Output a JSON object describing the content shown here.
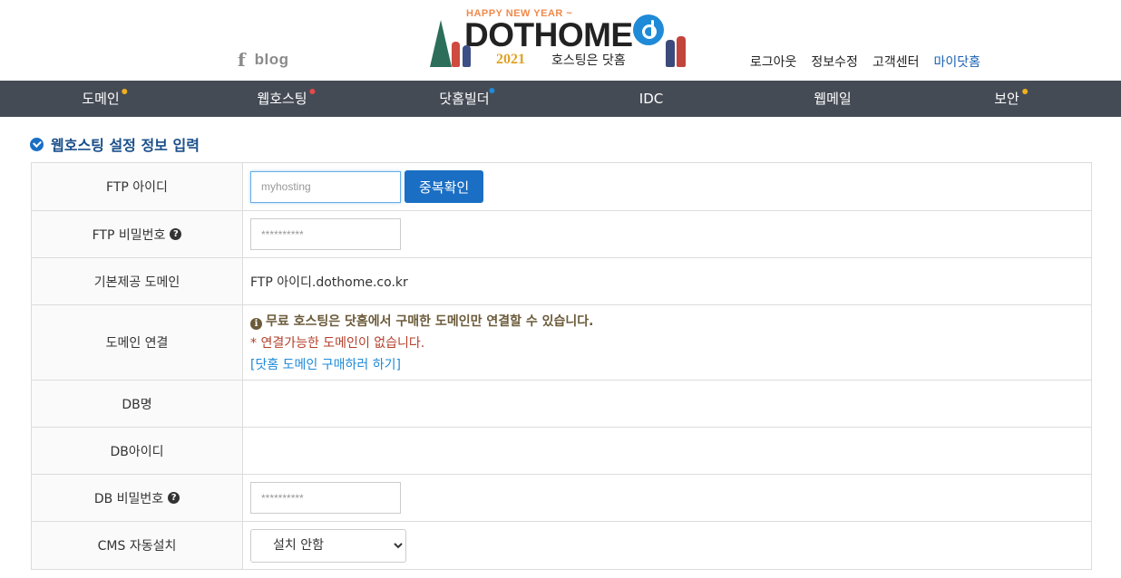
{
  "header": {
    "social": {
      "facebook_glyph": "f",
      "blog_label": "blog"
    },
    "logo": {
      "banner": "HAPPY NEW YEAR ~",
      "brand": "DOTHOME",
      "year": "2021",
      "tagline": "호스팅은 닷홈"
    },
    "links": [
      {
        "label": "로그아웃"
      },
      {
        "label": "정보수정"
      },
      {
        "label": "고객센터"
      },
      {
        "label": "마이닷홈"
      }
    ]
  },
  "nav": {
    "items": [
      {
        "label": "도메인",
        "dot_color": "#f2b01e"
      },
      {
        "label": "웹호스팅",
        "dot_color": "#e84a4a"
      },
      {
        "label": "닷홈빌더",
        "dot_color": "#1f8ad8"
      },
      {
        "label": "IDC",
        "dot_color": ""
      },
      {
        "label": "웹메일",
        "dot_color": ""
      },
      {
        "label": "보안",
        "dot_color": "#f2b01e"
      }
    ]
  },
  "section": {
    "title": "웹호스팅 설정 정보 입력"
  },
  "form": {
    "ftp_id": {
      "label": "FTP 아이디",
      "placeholder": "myhosting",
      "check_button": "중복확인"
    },
    "ftp_password": {
      "label": "FTP 비밀번호",
      "value": "**********"
    },
    "default_domain": {
      "label": "기본제공 도메인",
      "value": "FTP 아이디.dothome.co.kr"
    },
    "domain_connect": {
      "label": "도메인 연결",
      "notice": "무료 호스팅은 닷홈에서 구매한 도메인만 연결할 수 있습니다.",
      "warning": "* 연결가능한 도메인이 없습니다.",
      "link": "[닷홈 도메인 구매하러 하기]"
    },
    "db_name": {
      "label": "DB명",
      "value": ""
    },
    "db_id": {
      "label": "DB아이디",
      "value": ""
    },
    "db_password": {
      "label": "DB 비밀번호",
      "value": "**********"
    },
    "cms": {
      "label": "CMS 자동설치",
      "selected": "설치 안함"
    }
  },
  "colors": {
    "accent": "#1a6fc4",
    "nav_bg": "#454b55",
    "notice": "#6b5b3a",
    "warning": "#b33f2a",
    "link": "#1f8ad8"
  }
}
